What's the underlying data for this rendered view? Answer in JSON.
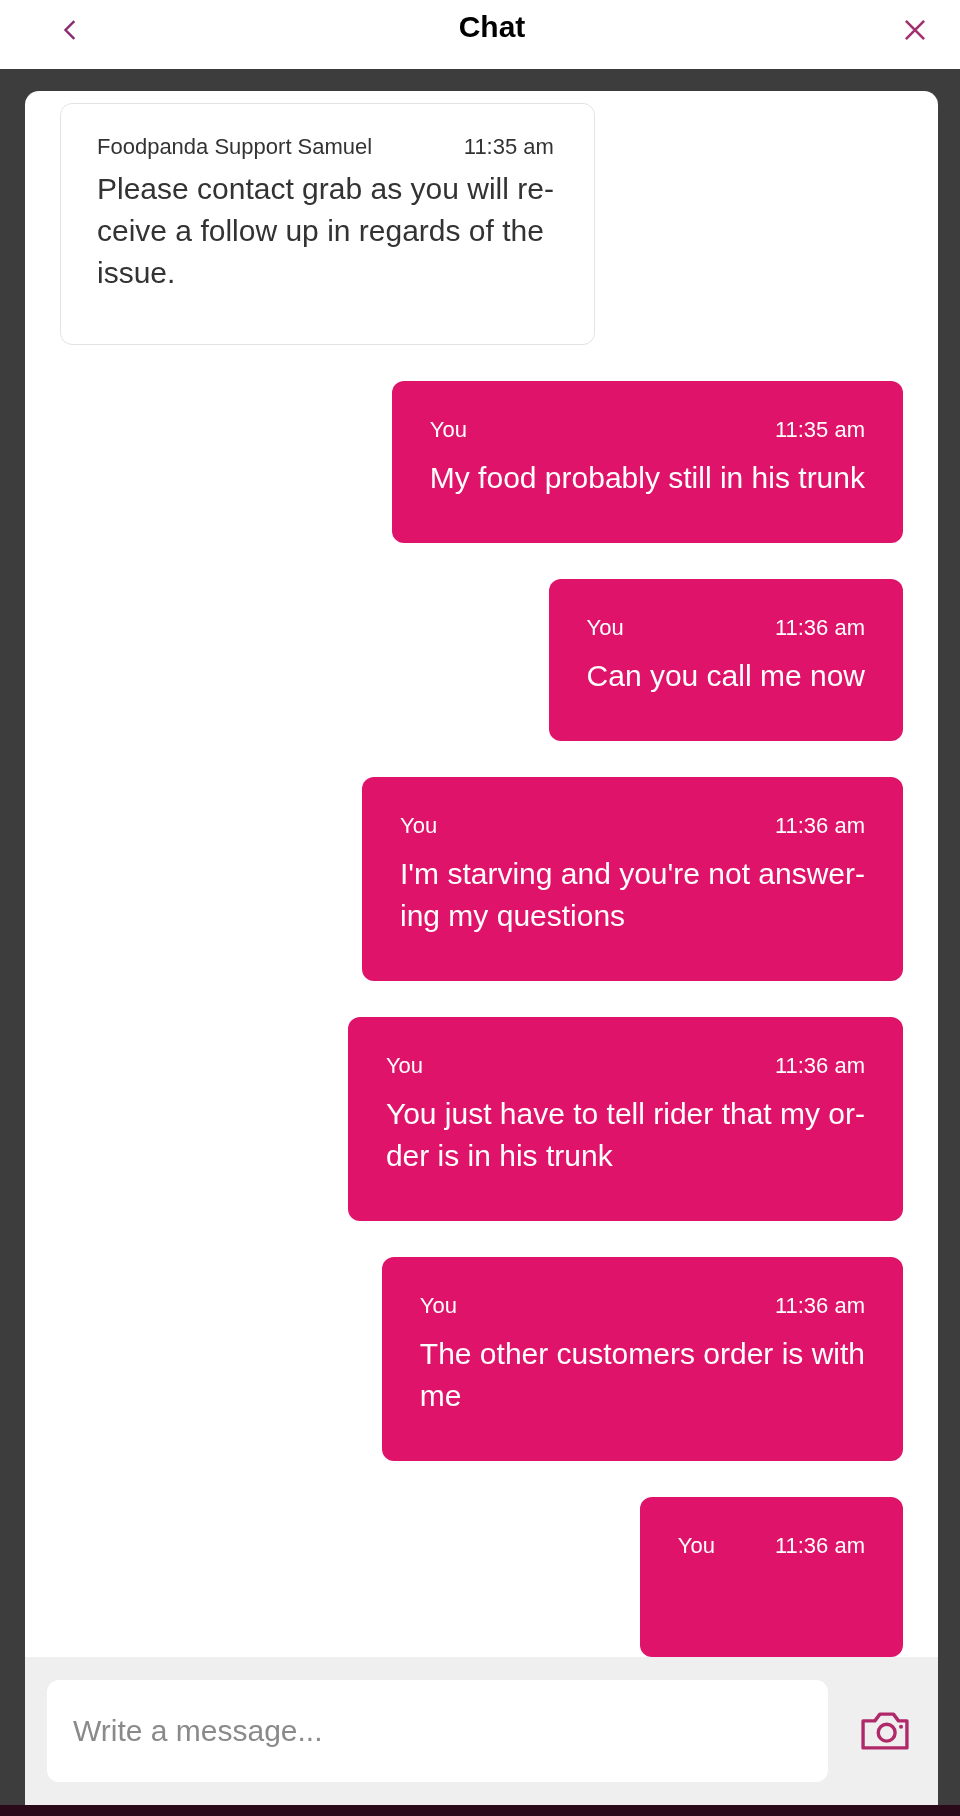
{
  "header": {
    "title": "Chat"
  },
  "messages": [
    {
      "kind": "incoming",
      "sender": "Foodpanda Support Samuel",
      "time": "11:35 am",
      "text": "Please contact grab as you will re-\nceive a follow up in regards of the\nissue."
    },
    {
      "kind": "outgoing",
      "sender": "You",
      "time": "11:35 am",
      "text": "My food probably still in his trunk"
    },
    {
      "kind": "outgoing",
      "sender": "You",
      "time": "11:36 am",
      "text": "Can you call me now"
    },
    {
      "kind": "outgoing",
      "sender": "You",
      "time": "11:36 am",
      "text": "I'm starving and you're not answer-\ning my questions"
    },
    {
      "kind": "outgoing",
      "sender": "You",
      "time": "11:36 am",
      "text": "You just have to tell rider that my or-\nder is in his trunk"
    },
    {
      "kind": "outgoing",
      "sender": "You",
      "time": "11:36 am",
      "text": "The other customers order is with\nme"
    },
    {
      "kind": "outgoing",
      "sender": "You",
      "time": "11:36 am"
    }
  ],
  "composer": {
    "placeholder": "Write a message..."
  }
}
